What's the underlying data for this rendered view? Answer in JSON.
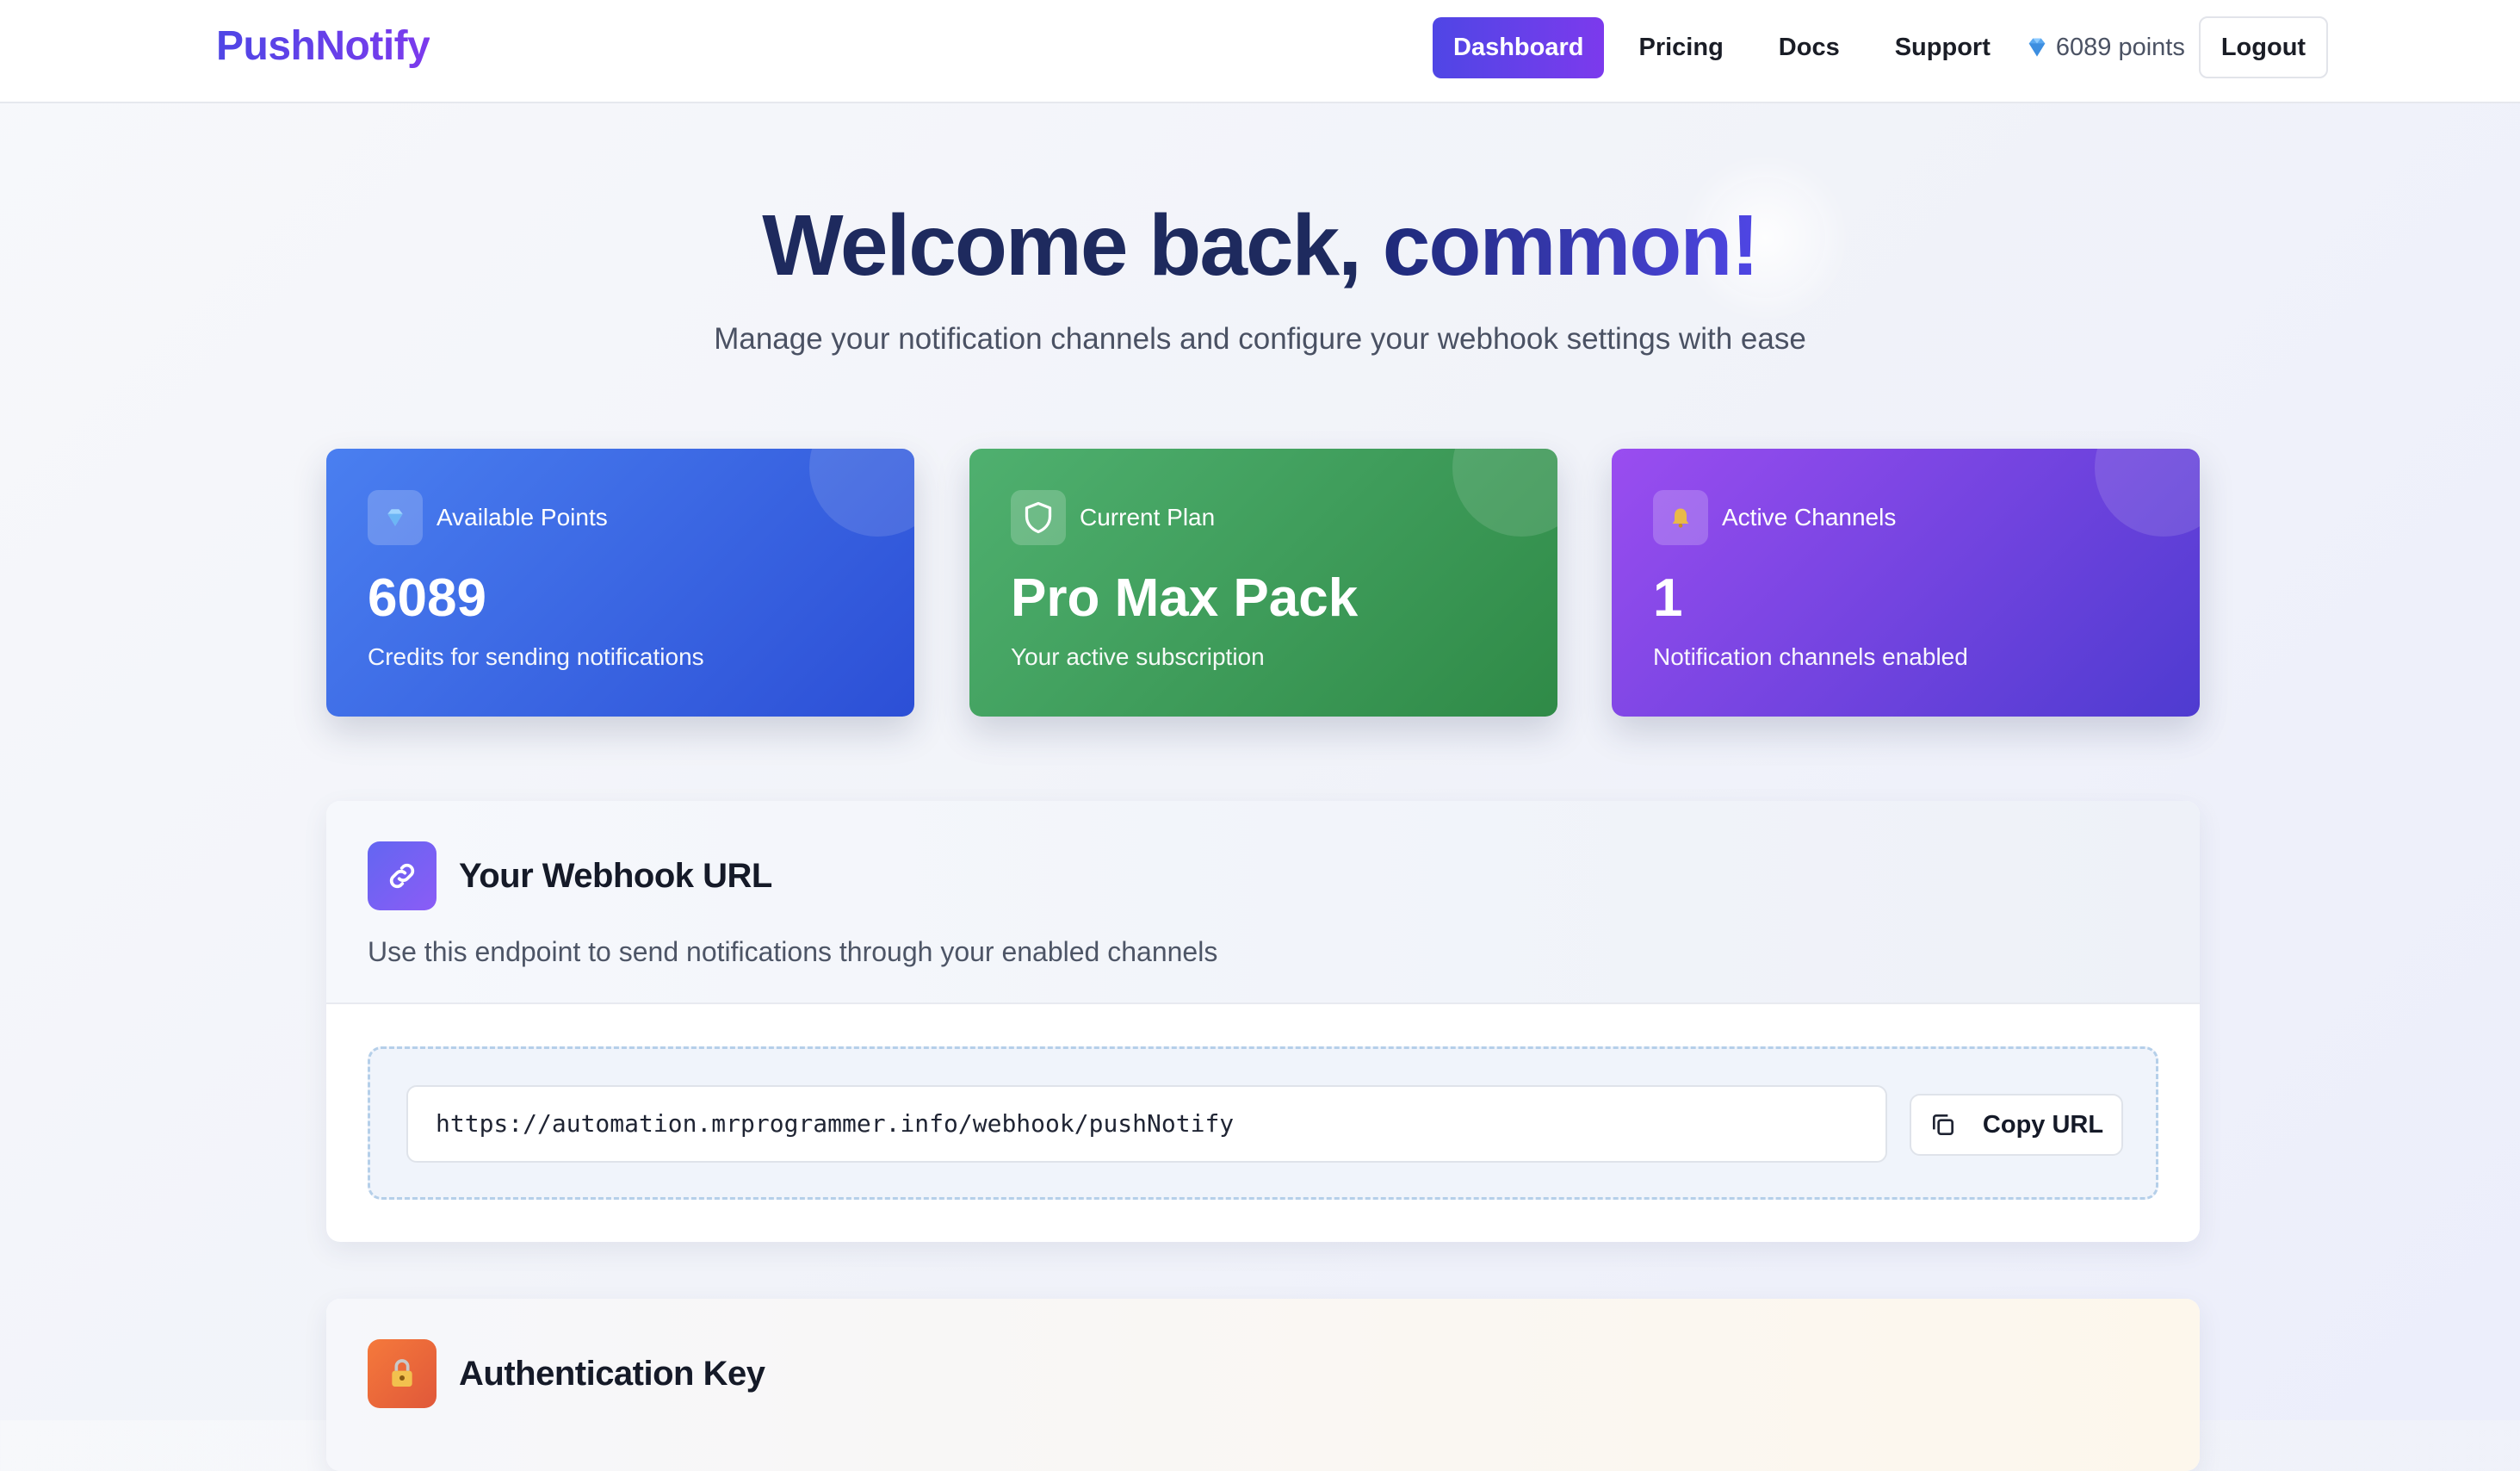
{
  "nav": {
    "logo": "PushNotify",
    "links": [
      {
        "label": "Dashboard",
        "active": true
      },
      {
        "label": "Pricing",
        "active": false
      },
      {
        "label": "Docs",
        "active": false
      },
      {
        "label": "Support",
        "active": false
      }
    ],
    "points_label": "6089 points",
    "logout_label": "Logout"
  },
  "hero": {
    "title_prefix": "Welcome back,",
    "title_name": "common!",
    "subtitle": "Manage your notification channels and configure your webhook settings with ease"
  },
  "stats": [
    {
      "label": "Available Points",
      "value": "6089",
      "description": "Credits for sending notifications",
      "icon": "gem-icon",
      "color": "#3b68e6"
    },
    {
      "label": "Current Plan",
      "value": "Pro Max Pack",
      "description": "Your active subscription",
      "icon": "shield-icon",
      "color": "#3f9c5b"
    },
    {
      "label": "Active Channels",
      "value": "1",
      "description": "Notification channels enabled",
      "icon": "bell-icon",
      "color": "#7a45e6"
    }
  ],
  "webhook": {
    "title": "Your Webhook URL",
    "subtitle": "Use this endpoint to send notifications through your enabled channels",
    "url": "https://automation.mrprogrammer.info/webhook/pushNotify",
    "copy_label": "Copy URL",
    "icon": "link-icon"
  },
  "auth": {
    "title": "Authentication Key",
    "icon": "lock-icon"
  },
  "colors": {
    "accent_start": "#4f46e5",
    "accent_end": "#7c3aed"
  }
}
